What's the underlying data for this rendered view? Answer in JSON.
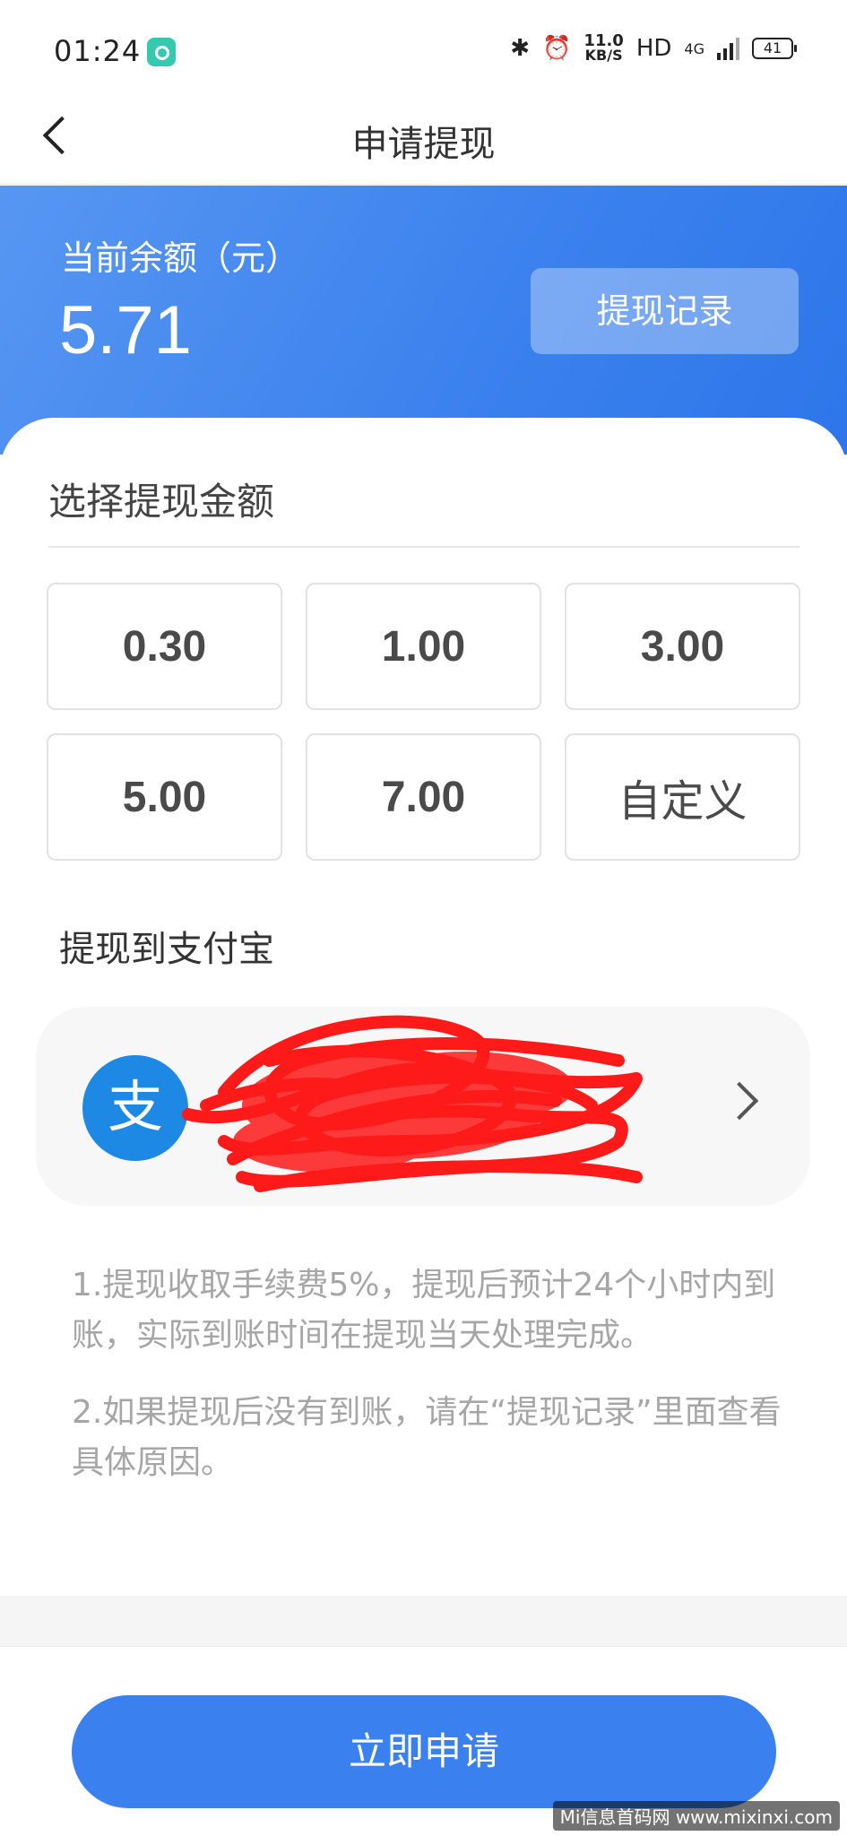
{
  "status_bar": {
    "time": "01:24",
    "speed_value": "11.0",
    "speed_unit": "KB/S",
    "hd": "HD",
    "network": "4G",
    "battery": "41"
  },
  "nav": {
    "title": "申请提现"
  },
  "balance": {
    "label": "当前余额（元）",
    "value": "5.71",
    "record_button": "提现记录"
  },
  "amount_section": {
    "title": "选择提现金额",
    "options": [
      "0.30",
      "1.00",
      "3.00",
      "5.00",
      "7.00",
      "自定义"
    ]
  },
  "payment": {
    "title": "提现到支付宝",
    "icon_text": "支"
  },
  "notes": [
    "1.提现收取手续费5%，提现后预计24个小时内到账，实际到账时间在提现当天处理完成。",
    "2.如果提现后没有到账，请在“提现记录”里面查看具体原因。"
  ],
  "apply_button": "立即申请",
  "watermark": "Mi信息首码网 www.mixinxi.com",
  "colors": {
    "accent": "#3b80ef",
    "header_start": "#5797f2",
    "header_end": "#2d76ea",
    "alipay": "#1e88e5",
    "scribble": "#ff1a1a"
  }
}
